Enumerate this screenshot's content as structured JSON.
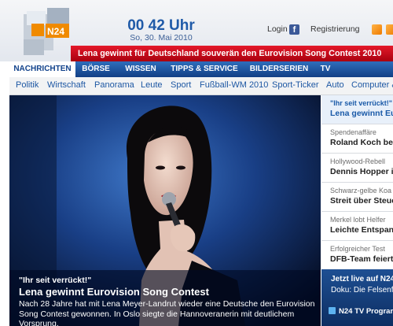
{
  "header": {
    "brand": "N24",
    "time": "00 42 Uhr",
    "date": "So, 30. Mai 2010",
    "login_label": "Login",
    "login_icon": "facebook-icon",
    "register_label": "Registrierung",
    "rss_icon": "rss-icon"
  },
  "ticker": {
    "text": "Lena gewinnt für Deutschland souverän den Eurovision Song Contest 2010"
  },
  "nav": {
    "items": [
      "NACHRICHTEN",
      "BÖRSE",
      "WISSEN",
      "TIPPS & SERVICE",
      "BILDERSERIEN",
      "TV"
    ],
    "active_index": 0
  },
  "subnav": {
    "items": [
      "Politik",
      "Wirtschaft",
      "Panorama",
      "Leute",
      "Sport",
      "Fußball-WM 2010",
      "Sport-Ticker",
      "Auto",
      "Computer &"
    ]
  },
  "hero": {
    "kicker": "\"Ihr seit verrückt!\"",
    "headline": "Lena gewinnt Eurovision Song Contest",
    "teaser": "Nach 28 Jahre hat mit Lena Meyer-Landrut wieder eine Deutsche den Eurovision Song Contest gewonnen. In Oslo siegte die Hannoveranerin mit deutlichem Vorsprung."
  },
  "sidebar": {
    "stories": [
      {
        "kicker": "\"Ihr seit verrückt!\"",
        "headline": "Lena gewinnt Eu"
      },
      {
        "kicker": "Spendenaffäre",
        "headline": "Roland Koch bes"
      },
      {
        "kicker": "Hollywood-Rebell",
        "headline": "Dennis Hopper is"
      },
      {
        "kicker": "Schwarz-gelbe Koa",
        "headline": "Streit über Steuer"
      },
      {
        "kicker": "Merkel lobt Helfer",
        "headline": "Leichte Entspann"
      },
      {
        "kicker": "Erfolgreicher Test",
        "headline": "DFB-Team feiert S"
      }
    ],
    "tv": {
      "title": "Jetzt live auf N24",
      "description": "Doku: Die Felsenf",
      "program_label": "N24 TV Program"
    }
  },
  "colors": {
    "ticker_red": "#d0101f",
    "nav_blue": "#1d55a0",
    "link_blue": "#1d57a3",
    "logo_orange": "#f08a00"
  }
}
